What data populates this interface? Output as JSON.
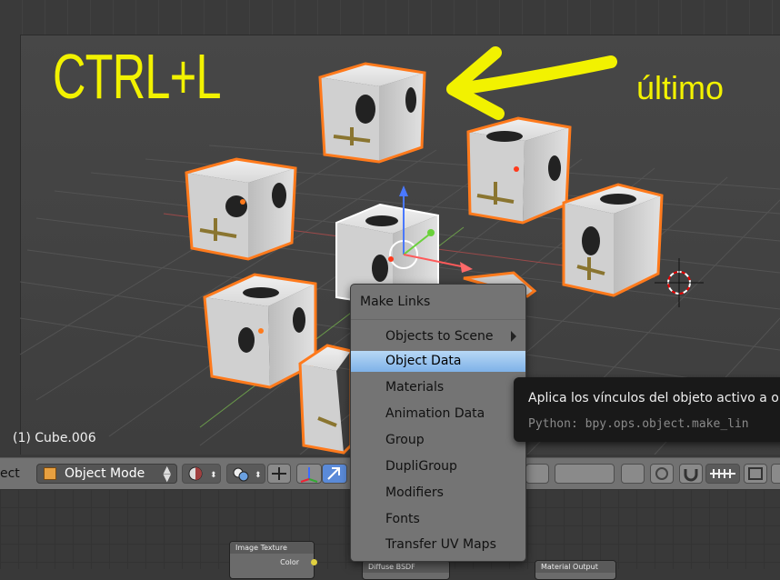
{
  "overlay": {
    "shortcut": "CTRL+L",
    "last_label": "último"
  },
  "viewport": {
    "object_info": "(1) Cube.006"
  },
  "header": {
    "editor_label_fragment": "ect",
    "mode": "Object Mode"
  },
  "context_menu": {
    "title": "Make Links",
    "items": [
      {
        "label": "Objects to Scene",
        "submenu": true
      },
      {
        "label": "Object Data",
        "active": true
      },
      {
        "label": "Materials"
      },
      {
        "label": "Animation Data"
      },
      {
        "label": "Group"
      },
      {
        "label": "DupliGroup"
      },
      {
        "label": "Modifiers"
      },
      {
        "label": "Fonts"
      },
      {
        "label": "Transfer UV Maps"
      }
    ]
  },
  "tooltip": {
    "description": "Aplica los vínculos del objeto activo a o",
    "python": "Python: bpy.ops.object.make_lin"
  },
  "node_editor": {
    "nodes": [
      {
        "title": "Image Texture",
        "socket": "Color"
      },
      {
        "title": "Diffuse BSDF"
      },
      {
        "title": "Material Output"
      }
    ]
  },
  "colors": {
    "annotation_yellow": "#f2f200",
    "selection_orange": "#ff7a1c",
    "menu_highlight": "#8fbde9"
  }
}
